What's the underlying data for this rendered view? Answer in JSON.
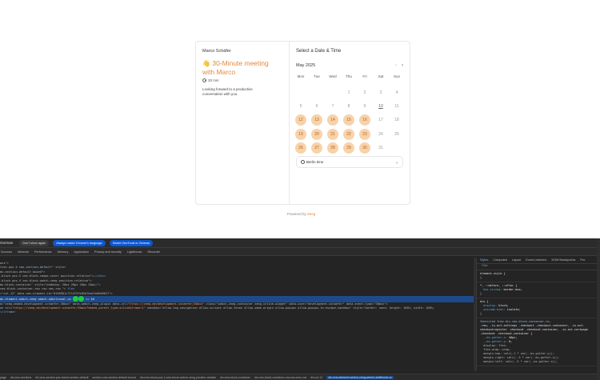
{
  "booking": {
    "host": "Marco Schäfer",
    "emoji": "👋",
    "title": "30-Minute meeting with Marco",
    "duration": "30 min",
    "description": "Looking forward to a productive conversation with you.",
    "select_title": "Select a Date & Time",
    "month": "May 2025",
    "prev_icon": "‹",
    "next_icon": "›",
    "weekdays": [
      "Mon",
      "Tue",
      "Wed",
      "Thu",
      "Fri",
      "Sat",
      "Sun"
    ],
    "timezone": "Berlin time",
    "powered_label": "Powered by",
    "powered_brand": "Zeeg"
  },
  "calendar": {
    "rows": [
      [
        null,
        null,
        null,
        "1",
        "2",
        "3",
        "4"
      ],
      [
        "5",
        "6",
        "7",
        "8",
        "9",
        "10",
        "11"
      ],
      [
        "12",
        "13",
        "14",
        "15",
        "16",
        "17",
        "18"
      ],
      [
        "19",
        "20",
        "21",
        "22",
        "23",
        "24",
        "25"
      ],
      [
        "26",
        "27",
        "28",
        "29",
        "30",
        "31",
        null
      ]
    ],
    "available": [
      "12",
      "13",
      "14",
      "15",
      "16",
      "19",
      "20",
      "21",
      "22",
      "23",
      "26",
      "27",
      "28",
      "29",
      "30"
    ],
    "today": "10"
  },
  "devtools": {
    "language": "German",
    "btn_dont_show": "Don't show again",
    "btn_match": "Always match Chrome's language",
    "btn_switch": "Switch DevTools to German",
    "tabs": [
      "Sources",
      "Network",
      "Performance",
      "Memory",
      "Application",
      "Privacy and security",
      "Lighthouse",
      "Recorder"
    ],
    "side_tabs": [
      "Styles",
      "Computed",
      "Layout",
      "Event Listeners",
      "DOM Breakpoints",
      "Pro"
    ],
    "filter": "Filter",
    "crumbs": [
      "page",
      "div.cms-sections",
      "div.cms-section.pos-frame-section-default",
      "section.cms-section-default.boxed",
      "div.cms-block.pos-1.cms-block-webch-zeeg.position-relative",
      "div.cms-block-container",
      "div.cms-block-container-row.row.cms-row",
      "div.col-12",
      "div.cms-element-webch-zeeg.webch-additional-co"
    ]
  }
}
